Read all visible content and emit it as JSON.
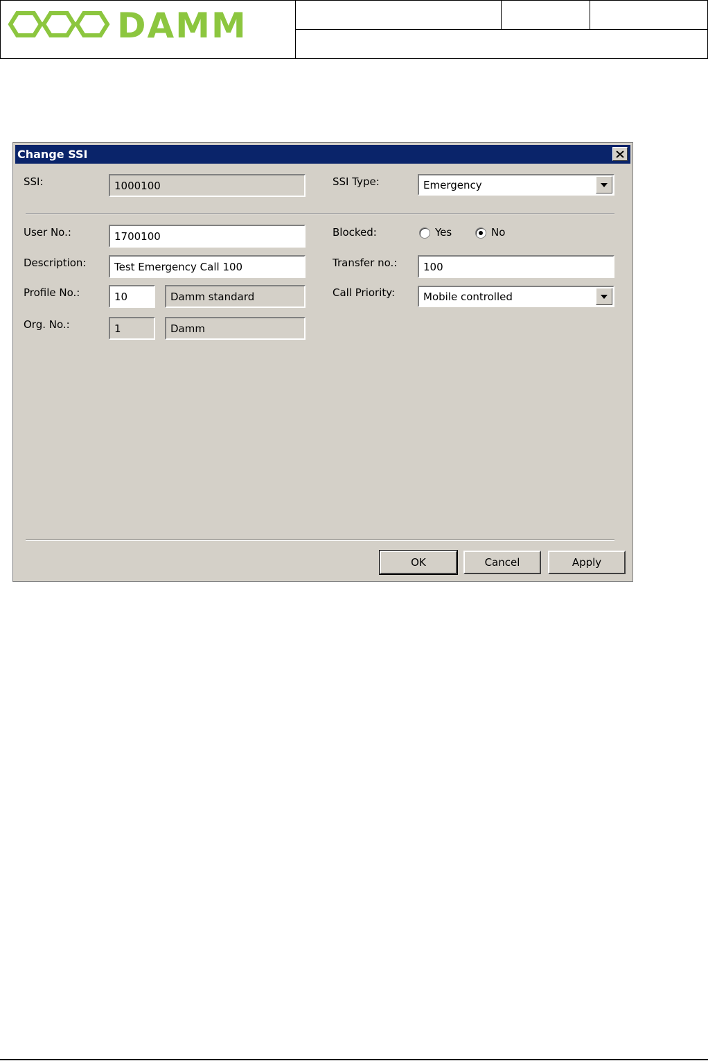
{
  "header": {
    "logo_text": "DAMM",
    "brand_color": "#8cc63f"
  },
  "dialog": {
    "title": "Change SSI",
    "ssi": {
      "label": "SSI:",
      "value": "1000100"
    },
    "ssi_type": {
      "label": "SSI Type:",
      "value": "Emergency"
    },
    "user_no": {
      "label": "User No.:",
      "value": "1700100"
    },
    "blocked": {
      "label": "Blocked:",
      "yes_label": "Yes",
      "no_label": "No",
      "selected": "No"
    },
    "description": {
      "label": "Description:",
      "value": "Test Emergency Call 100"
    },
    "transfer_no": {
      "label": "Transfer no.:",
      "value": "100"
    },
    "profile_no": {
      "label": "Profile No.:",
      "value": "10",
      "name": "Damm standard"
    },
    "call_priority": {
      "label": "Call Priority:",
      "value": "Mobile controlled"
    },
    "org_no": {
      "label": "Org. No.:",
      "value": "1",
      "name": "Damm"
    },
    "buttons": {
      "ok": "OK",
      "cancel": "Cancel",
      "apply": "Apply"
    }
  },
  "icons": {
    "close": "close-icon",
    "dropdown": "chevron-down-icon",
    "logo": "damm-logo"
  }
}
